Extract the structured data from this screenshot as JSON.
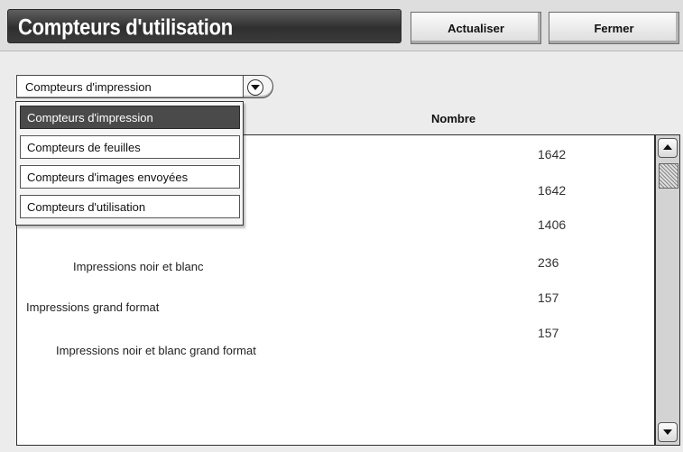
{
  "header": {
    "title": "Compteurs d'utilisation",
    "refresh_label": "Actualiser",
    "close_label": "Fermer"
  },
  "counter_select": {
    "selected": "Compteurs d'impression",
    "options": [
      "Compteurs d'impression",
      "Compteurs de feuilles",
      "Compteurs d'images envoyées",
      "Compteurs d'utilisation"
    ]
  },
  "table": {
    "column_header": "Nombre",
    "rows": [
      {
        "label": "",
        "value": "1642"
      },
      {
        "label": "",
        "value": "1642"
      },
      {
        "label": "",
        "value": "1406"
      },
      {
        "label": "Impressions noir et blanc",
        "value": "236"
      },
      {
        "label": "Impressions grand format",
        "value": "157"
      },
      {
        "label": "Impressions noir et blanc grand format",
        "value": "157"
      }
    ]
  },
  "icons": {
    "dropdown": "chevron-down-icon",
    "scroll_up": "arrow-up-icon",
    "scroll_down": "arrow-down-icon"
  }
}
